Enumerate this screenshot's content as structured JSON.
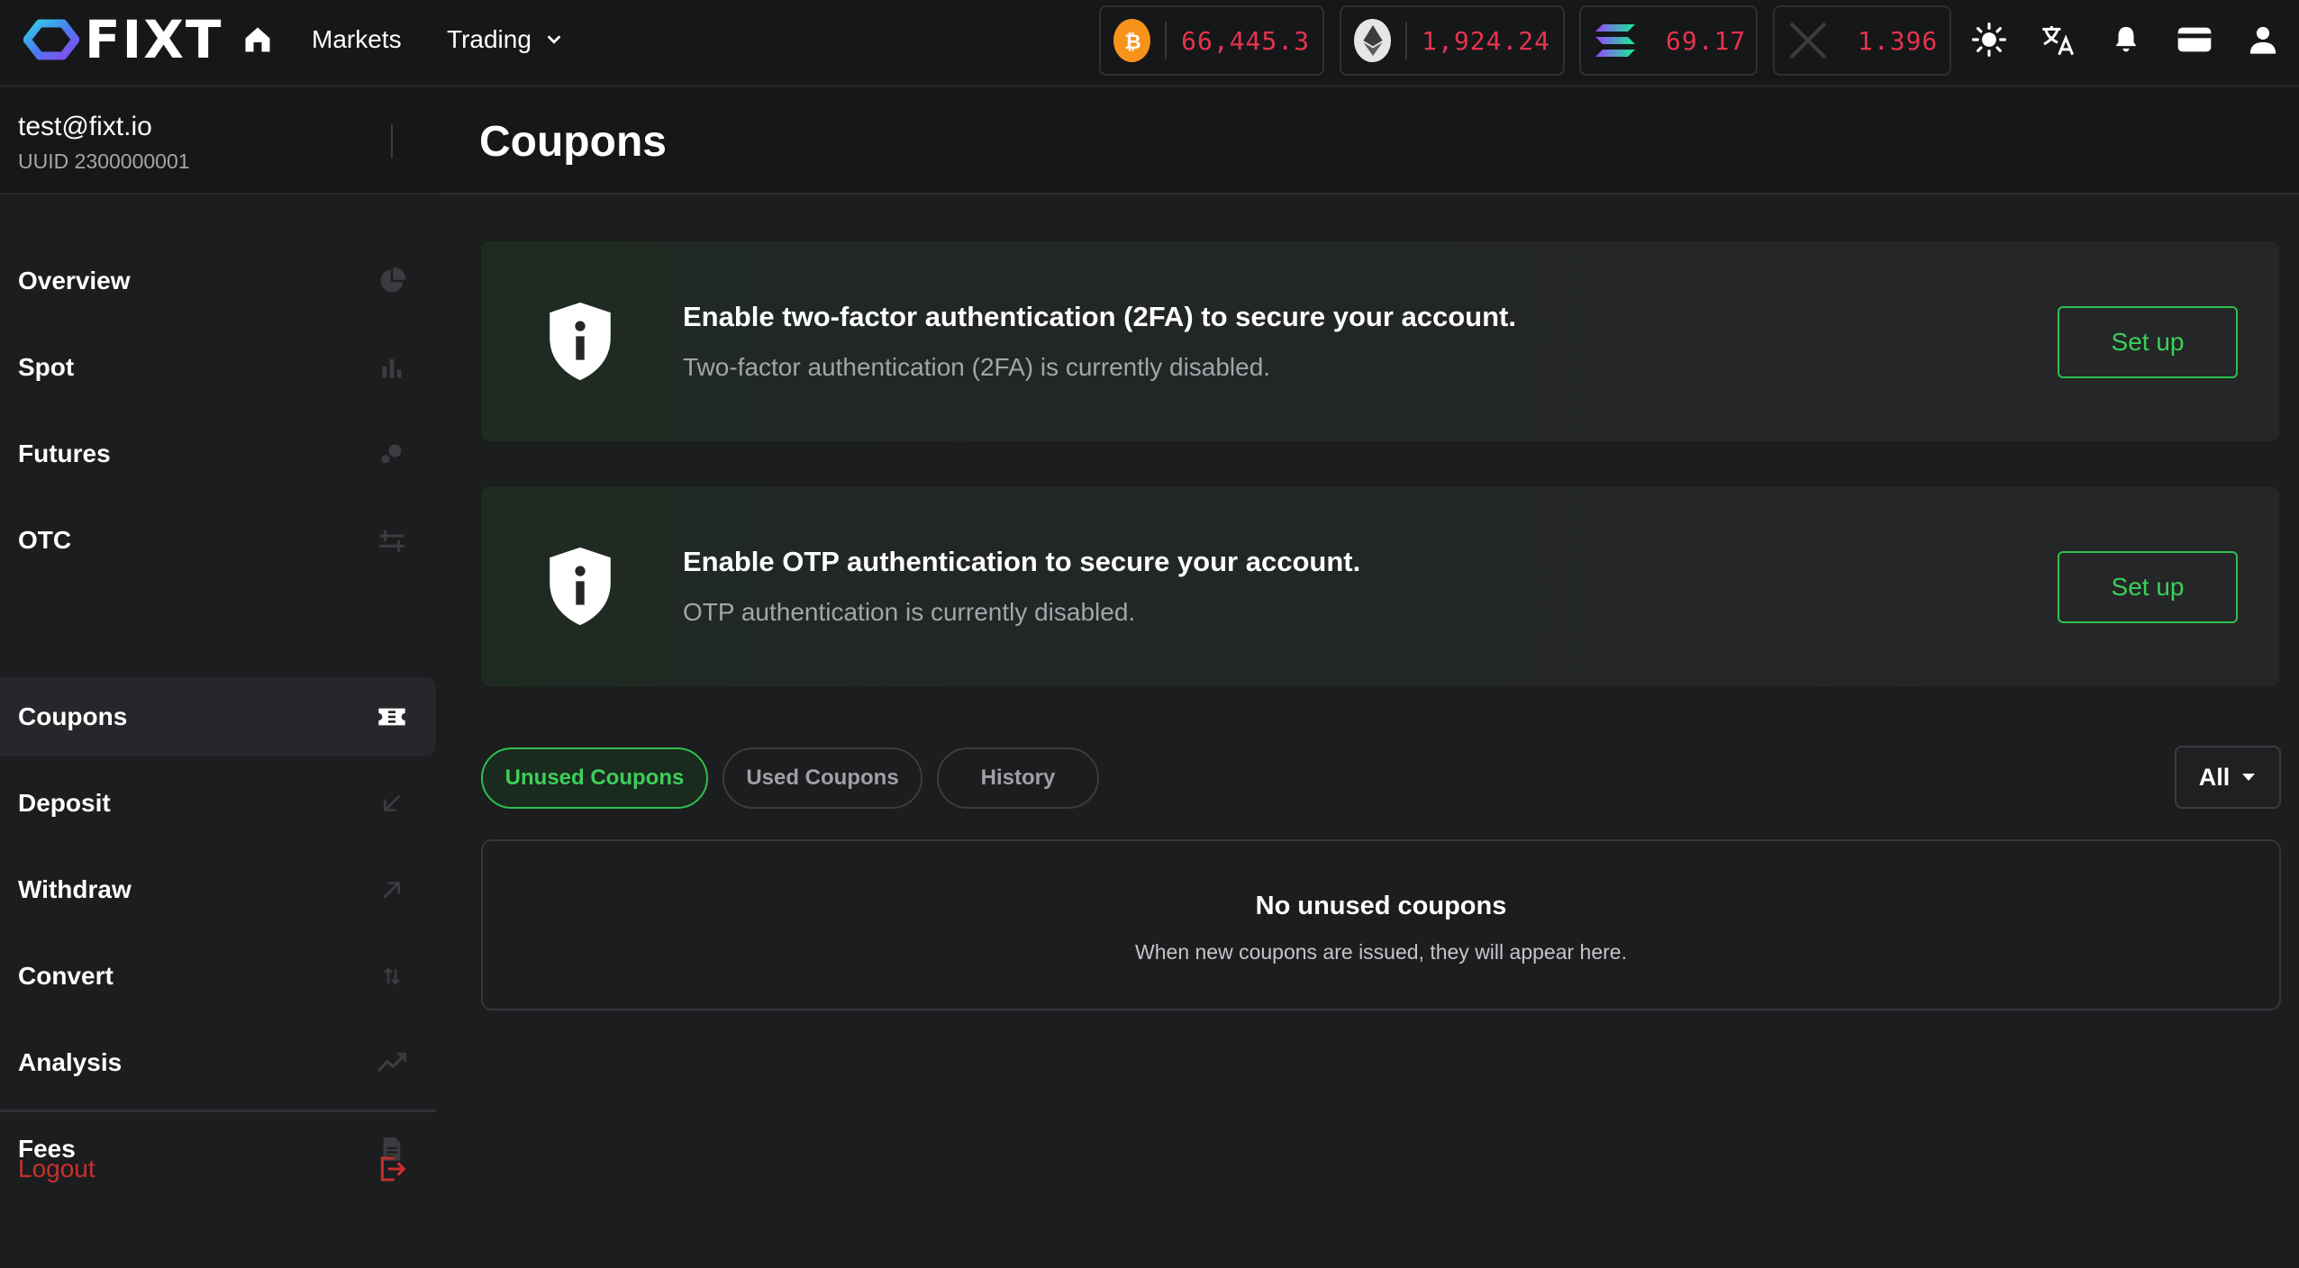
{
  "brand": {
    "name": "FIXT"
  },
  "nav": {
    "markets": "Markets",
    "trading": "Trading"
  },
  "tickers": [
    {
      "symbol": "BTC",
      "price": "66,445.3",
      "icon": "bitcoin-icon"
    },
    {
      "symbol": "ETH",
      "price": "1,924.24",
      "icon": "ethereum-icon"
    },
    {
      "symbol": "SOL",
      "price": "69.17",
      "icon": "solana-icon"
    },
    {
      "symbol": "X",
      "price": "1.396",
      "icon": "x-coin-icon"
    }
  ],
  "account": {
    "email": "test@fixt.io",
    "uuid": "UUID 2300000001"
  },
  "sidebar": {
    "items": [
      {
        "label": "Overview",
        "icon": "pie-chart-icon"
      },
      {
        "label": "Spot",
        "icon": "bar-chart-icon"
      },
      {
        "label": "Futures",
        "icon": "bubbles-icon"
      },
      {
        "label": "OTC",
        "icon": "otc-arrows-icon"
      },
      {
        "label": "Coupons",
        "icon": "ticket-icon",
        "active": true
      },
      {
        "label": "Deposit",
        "icon": "arrow-down-left-icon"
      },
      {
        "label": "Withdraw",
        "icon": "arrow-up-right-icon"
      },
      {
        "label": "Convert",
        "icon": "swap-vertical-icon"
      },
      {
        "label": "Analysis",
        "icon": "trend-line-icon"
      },
      {
        "label": "Fees",
        "icon": "document-icon"
      }
    ],
    "logout": "Logout"
  },
  "page": {
    "title": "Coupons"
  },
  "security": {
    "twofa": {
      "title": "Enable two-factor authentication (2FA) to secure your account.",
      "desc": "Two-factor authentication (2FA) is currently disabled.",
      "button": "Set up"
    },
    "otp": {
      "title": "Enable OTP authentication to secure your account.",
      "desc": "OTP authentication is currently disabled.",
      "button": "Set up"
    }
  },
  "tabs": {
    "unused": "Unused Coupons",
    "used": "Used Coupons",
    "history": "History"
  },
  "filter": {
    "selected": "All"
  },
  "empty": {
    "title": "No unused coupons",
    "desc": "When new coupons are issued, they will appear here."
  },
  "colors": {
    "accent": "#3ccf5a",
    "price_down": "#e5344f",
    "logout": "#c9302c"
  }
}
